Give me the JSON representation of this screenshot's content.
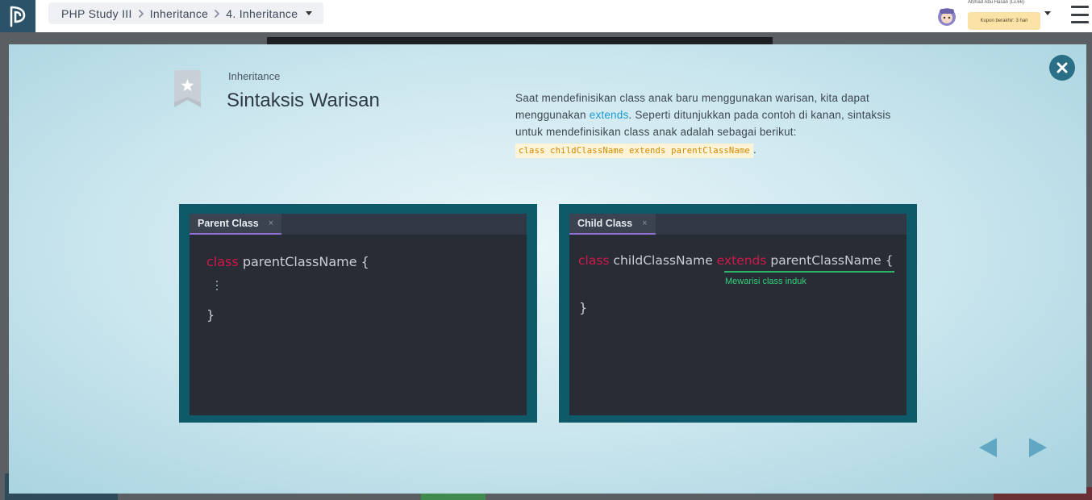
{
  "header": {
    "breadcrumbs": [
      "PHP Study III",
      "Inheritance",
      "4. Inheritance"
    ],
    "user": {
      "name": "Ahmad Abu Hasan (Lv.66)",
      "coupon": "Kupon berakhir: 3 hari"
    }
  },
  "slide": {
    "eyebrow": "Inheritance",
    "title": "Sintaksis Warisan",
    "description": {
      "part1": "Saat mendefinisikan class anak baru menggunakan warisan, kita dapat menggunakan ",
      "keyword": "extends",
      "part2": ". Seperti ditunjukkan pada contoh di kanan, sintaksis untuk mendefinisikan class anak adalah sebagai berikut:",
      "code": "class childClassName extends parentClassName",
      "end": "."
    },
    "parent_editor": {
      "tab": "Parent Class",
      "tab_close": "×",
      "kw_class": "class",
      "name": "parentClassName {",
      "close_brace": "}"
    },
    "child_editor": {
      "tab": "Child Class",
      "tab_close": "×",
      "kw_class": "class",
      "name": "childClassName",
      "kw_extends": "extends",
      "parent": "parentClassName",
      "open_brace": "{",
      "annotation": "Mewarisi class induk",
      "close_brace": "}"
    }
  },
  "colors": {
    "keyword": "#d2174a",
    "annotation": "#33d17a",
    "accent": "#1a9bd2",
    "editor_frame": "#0e5a69"
  }
}
